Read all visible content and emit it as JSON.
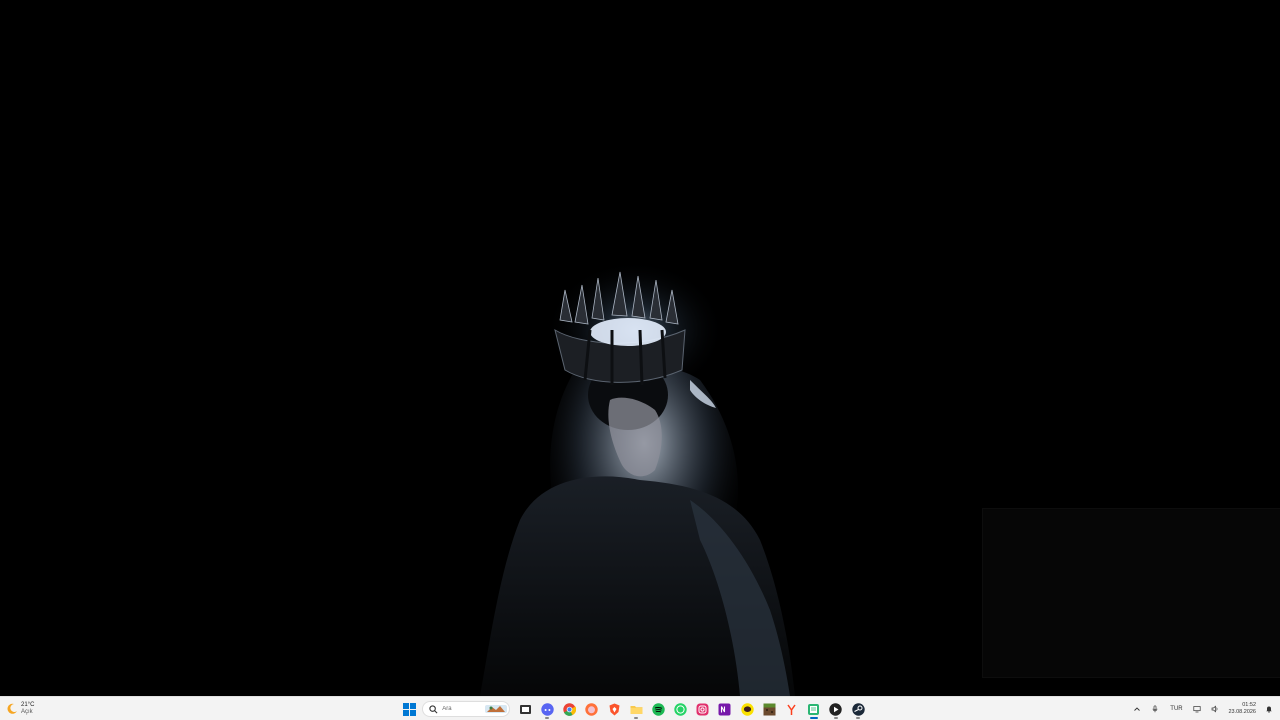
{
  "desktop": {
    "wallpaper_icon": "crowned-figure-wallpaper"
  },
  "taskbar": {
    "weather": {
      "temperature": "21°C",
      "condition": "Açık",
      "icon": "moon-icon"
    },
    "start_icon": "windows-logo-icon",
    "search": {
      "placeholder": "Ara",
      "icon": "search-icon"
    },
    "apps": [
      {
        "name": "task-view",
        "icon": "task-view-icon"
      },
      {
        "name": "discord",
        "icon": "discord-icon",
        "color": "#5865f2"
      },
      {
        "name": "chrome",
        "icon": "chrome-icon"
      },
      {
        "name": "firefox",
        "icon": "firefox-icon",
        "color": "#ff7139"
      },
      {
        "name": "brave",
        "icon": "brave-icon",
        "color": "#fb542b"
      },
      {
        "name": "file-explorer",
        "icon": "folder-icon",
        "color": "#f8c94c"
      },
      {
        "name": "spotify",
        "icon": "spotify-icon",
        "color": "#1db954"
      },
      {
        "name": "whatsapp",
        "icon": "whatsapp-icon",
        "color": "#25d366"
      },
      {
        "name": "instagram",
        "icon": "instagram-icon",
        "color": "#e1306c"
      },
      {
        "name": "onenote",
        "icon": "onenote-icon",
        "color": "#7719aa"
      },
      {
        "name": "kakaotalk",
        "icon": "kakaotalk-icon",
        "color": "#fae100"
      },
      {
        "name": "minecraft",
        "icon": "minecraft-icon",
        "color": "#6b4a2e"
      },
      {
        "name": "yandex",
        "icon": "yandex-icon",
        "color": "#fc3f1d"
      },
      {
        "name": "notepad",
        "icon": "notepad-icon",
        "color": "#2bb673"
      },
      {
        "name": "media-player",
        "icon": "play-icon",
        "color": "#222222"
      },
      {
        "name": "steam",
        "icon": "steam-icon",
        "color": "#1b2838"
      }
    ],
    "tray": {
      "chevron_icon": "chevron-up-icon",
      "mic_icon": "microphone-icon",
      "language": "TUR",
      "network_icon": "network-icon",
      "volume_icon": "speaker-icon",
      "time": "01:52",
      "date": "23.08.2026",
      "notification_icon": "bell-icon"
    },
    "accent": "#0067c0"
  }
}
